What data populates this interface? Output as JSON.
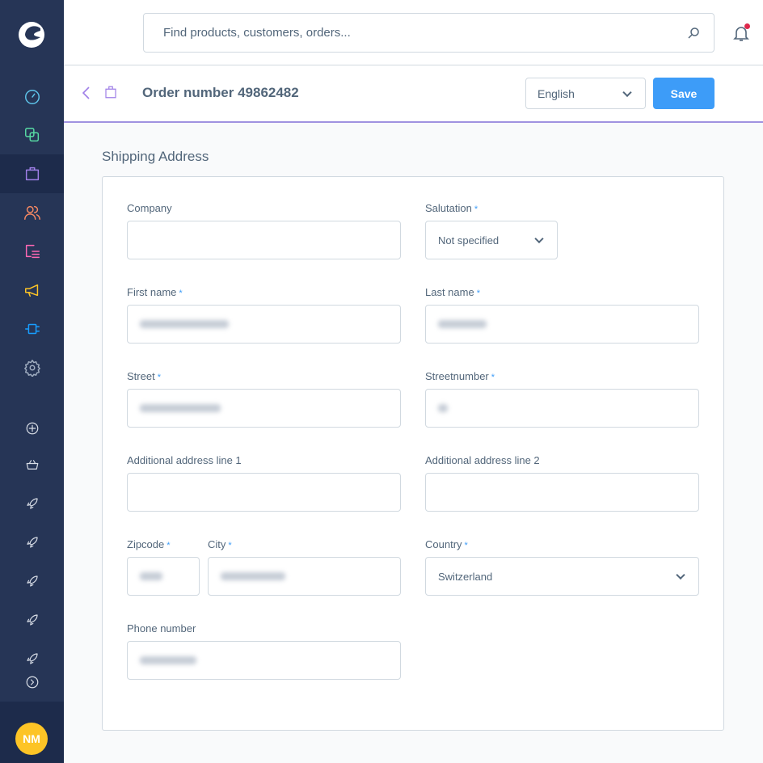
{
  "search": {
    "placeholder": "Find products, customers, orders..."
  },
  "header": {
    "title": "Order number 49862482",
    "language": "English",
    "save_label": "Save"
  },
  "sidebar": {
    "items": [
      {
        "icon": "dashboard-icon",
        "color": "#5ec4ea"
      },
      {
        "icon": "products-icon",
        "color": "#57d9a3"
      },
      {
        "icon": "orders-icon",
        "color": "#9f7fe7",
        "active": true
      },
      {
        "icon": "customers-icon",
        "color": "#f88962"
      },
      {
        "icon": "content-icon",
        "color": "#ff68b4"
      },
      {
        "icon": "marketing-icon",
        "color": "#fdc426"
      },
      {
        "icon": "extensions-icon",
        "color": "#189eff"
      },
      {
        "icon": "settings-icon",
        "color": "#a1aec1"
      }
    ],
    "avatar": "NM"
  },
  "form": {
    "section_title": "Shipping Address",
    "company": "Company",
    "salutation": "Salutation",
    "salutation_value": "Not specified",
    "first_name": "First name",
    "last_name": "Last name",
    "street": "Street",
    "streetnumber": "Streetnumber",
    "address1": "Additional address line 1",
    "address2": "Additional address line 2",
    "zipcode": "Zipcode",
    "city": "City",
    "country": "Country",
    "country_value": "Switzerland",
    "phone": "Phone number",
    "required": "*"
  },
  "colors": {
    "accent": "#3d9cf8",
    "sidebar": "#263556",
    "divider": "#a092e0"
  }
}
